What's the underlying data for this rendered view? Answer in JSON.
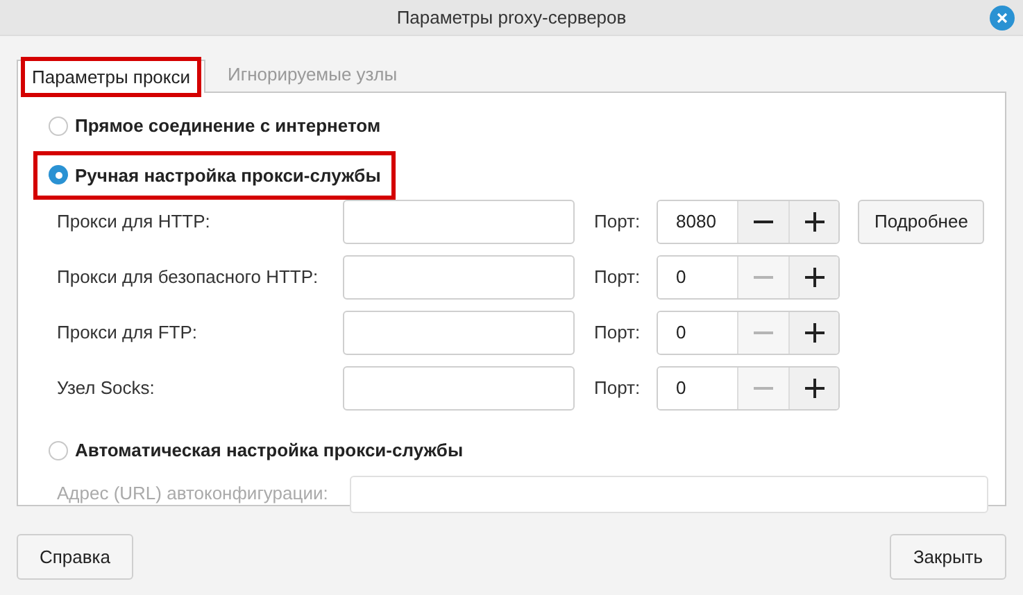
{
  "window": {
    "title": "Параметры proxy-серверов"
  },
  "tabs": [
    {
      "label": "Параметры прокси",
      "selected": true,
      "highlighted": true
    },
    {
      "label": "Игнорируемые узлы",
      "selected": false,
      "highlighted": false
    }
  ],
  "direct": {
    "label": "Прямое соединение с интернетом",
    "selected": false,
    "highlighted": false
  },
  "manual": {
    "label": "Ручная настройка прокси-службы",
    "selected": true,
    "highlighted": true,
    "rows": [
      {
        "label": "Прокси для HTTP:",
        "port_label": "Порт:",
        "port": "8080",
        "minus_disabled": false,
        "details_button": "Подробнее"
      },
      {
        "label": "Прокси для безопасного HTTP:",
        "port_label": "Порт:",
        "port": "0",
        "minus_disabled": true
      },
      {
        "label": "Прокси для FTP:",
        "port_label": "Порт:",
        "port": "0",
        "minus_disabled": true
      },
      {
        "label": "Узел Socks:",
        "port_label": "Порт:",
        "port": "0",
        "minus_disabled": true
      }
    ]
  },
  "auto": {
    "label": "Автоматическая настройка прокси-службы",
    "selected": false,
    "highlighted": false,
    "url_label": "Адрес (URL) автоконфигурации:",
    "url_disabled": true
  },
  "buttons": {
    "help": "Справка",
    "close": "Закрыть"
  }
}
